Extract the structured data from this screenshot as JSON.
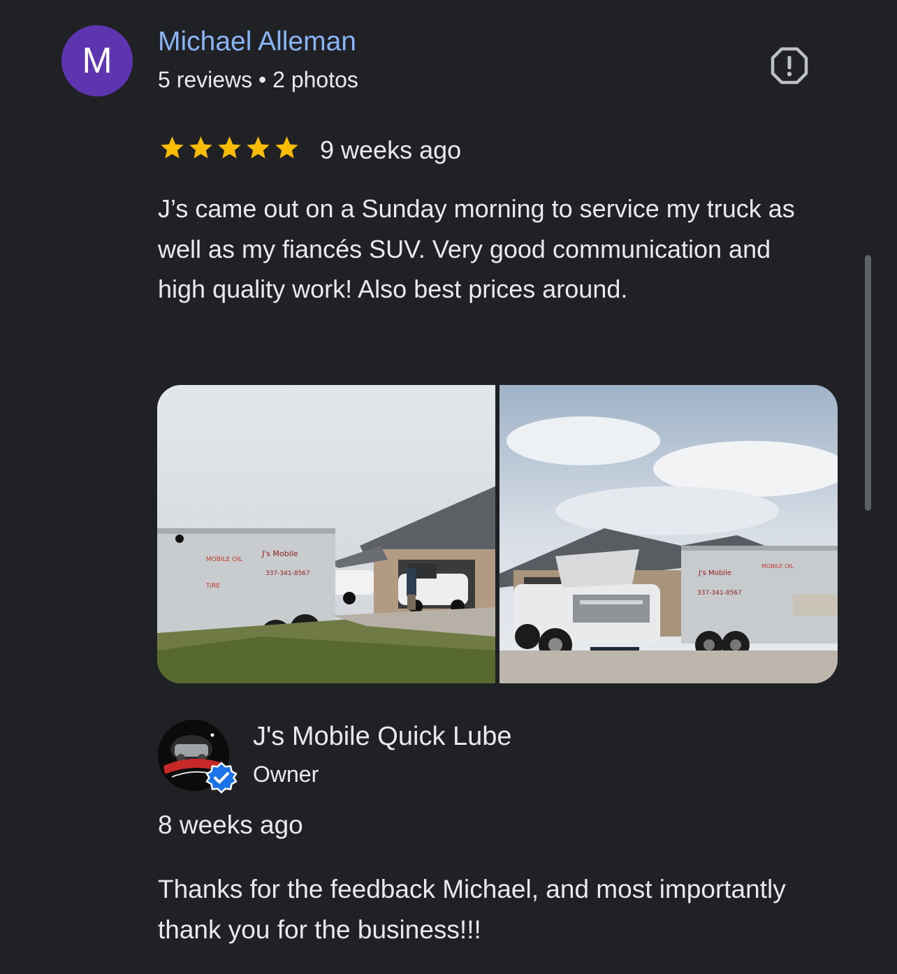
{
  "reviewer": {
    "initial": "M",
    "avatar_color": "#5e35b1",
    "name": "Michael Alleman",
    "meta": "5 reviews • 2 photos"
  },
  "review": {
    "rating": 5,
    "date": "9 weeks ago",
    "text": "J’s came out on a Sunday morning to service my truck as well as my fiancés SUV. Very good communication and high quality work! Also best prices around.",
    "photos": [
      {
        "icon": "trailer-and-house-photo"
      },
      {
        "icon": "truck-and-trailer-photo"
      }
    ]
  },
  "owner_reply": {
    "name": "J's Mobile Quick Lube",
    "role": "Owner",
    "date": "8 weeks ago",
    "text": "Thanks for the feedback Michael, and most importantly thank you for the business!!!",
    "logo_text": "J's Mobile Quick Lube",
    "verified_color": "#1a73e8"
  },
  "icons": {
    "report": "report-flag-icon",
    "star": "star-icon",
    "verified": "verified-badge-icon"
  },
  "colors": {
    "background": "#202124",
    "link": "#8ab4f8",
    "star": "#fbbc04",
    "text": "#e8eaed"
  }
}
